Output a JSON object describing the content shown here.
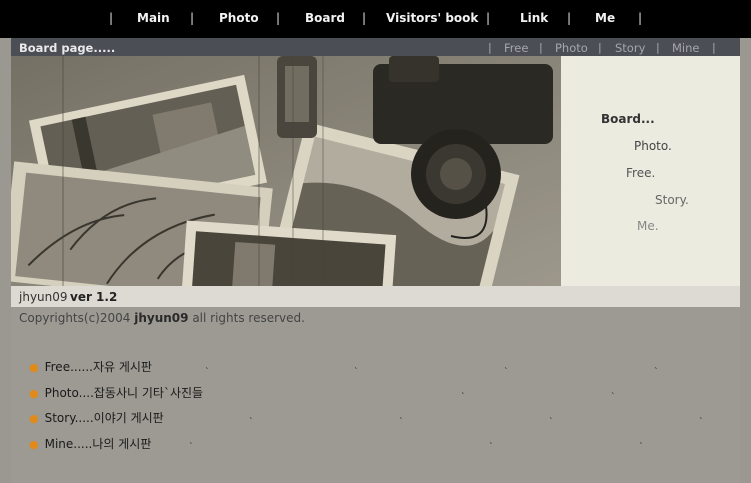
{
  "nav": {
    "items": [
      "Main",
      "Photo",
      "Board",
      "Visitors' book",
      "Link",
      "Me"
    ]
  },
  "subnav": {
    "title": "Board page.....",
    "items": [
      "Free",
      "Photo",
      "Story",
      "Mine"
    ]
  },
  "side_menu": {
    "items": [
      "Board...",
      "Photo.",
      "Free.",
      "Story.",
      "Me."
    ]
  },
  "info": {
    "author": "jhyun09",
    "version": "ver 1.2"
  },
  "copyright": {
    "prefix": "Copyrights(c)2004",
    "name": "jhyun09",
    "suffix": "all rights reserved."
  },
  "board_list": [
    "Free......자유 게시판",
    "Photo....잡동사니 기타`사진들",
    "Story.....이야기 게시판",
    "Mine.....나의 게시판"
  ],
  "colors": {
    "bullet": "#e08a1c",
    "topbar": "#000000",
    "subbar": "#4b4e55"
  }
}
